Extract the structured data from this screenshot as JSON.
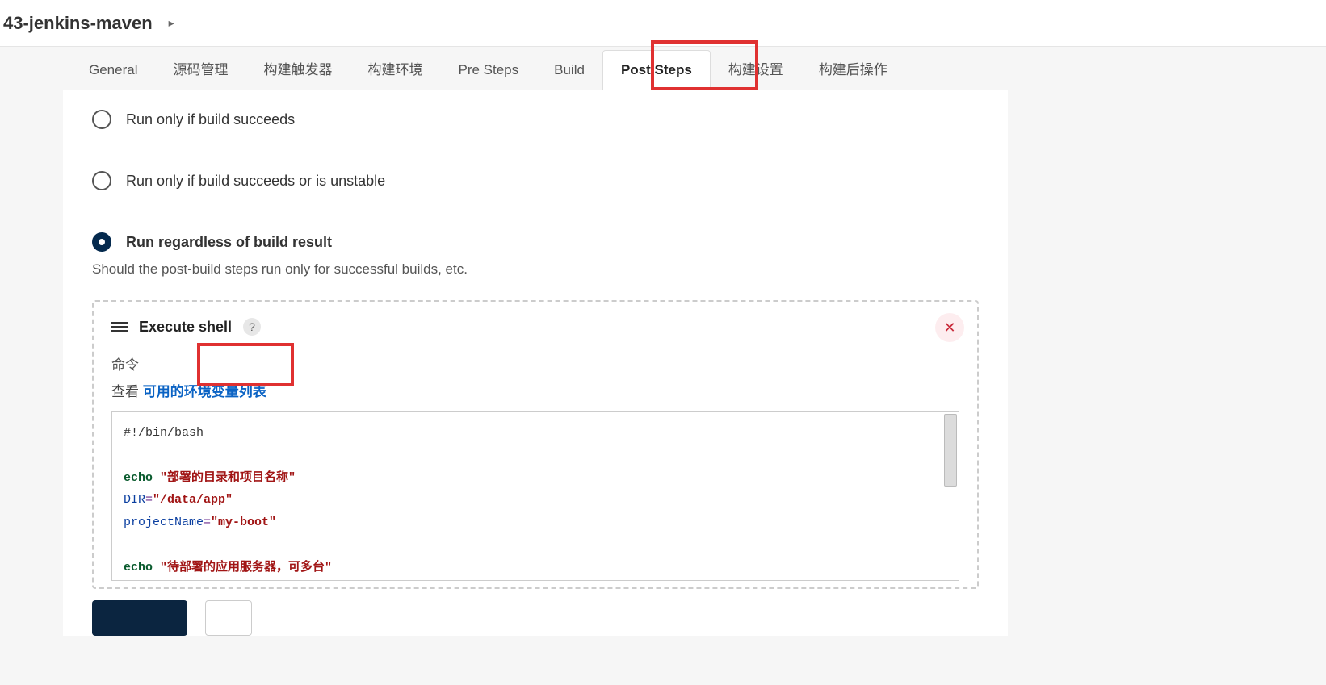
{
  "breadcrumb": {
    "title": "43-jenkins-maven",
    "caret": "▸"
  },
  "tabs": [
    {
      "label": "General"
    },
    {
      "label": "源码管理"
    },
    {
      "label": "构建触发器"
    },
    {
      "label": "构建环境"
    },
    {
      "label": "Pre Steps"
    },
    {
      "label": "Build"
    },
    {
      "label": "Post Steps",
      "active": true
    },
    {
      "label": "构建设置"
    },
    {
      "label": "构建后操作"
    }
  ],
  "radios": [
    {
      "label": "Run only if build succeeds",
      "selected": false
    },
    {
      "label": "Run only if build succeeds or is unstable",
      "selected": false
    },
    {
      "label": "Run regardless of build result",
      "selected": true
    }
  ],
  "help_text": "Should the post-build steps run only for successful builds, etc.",
  "step": {
    "title": "Execute shell",
    "help_char": "?",
    "delete_char": "✕",
    "field_label": "命令",
    "link_prefix": "查看 ",
    "link_text": "可用的环境变量列表",
    "code": {
      "l1": "#!/bin/bash",
      "l3_echo": "echo",
      "l3_str": "\"部署的目录和项目名称\"",
      "l4_var": "DIR",
      "l4_eq": "=",
      "l4_str": "\"/data/app\"",
      "l5_var": "projectName",
      "l5_eq": "=",
      "l5_str": "\"my-boot\"",
      "l7_echo": "echo",
      "l7_str": "\"待部署的应用服务器，可多台\""
    }
  }
}
